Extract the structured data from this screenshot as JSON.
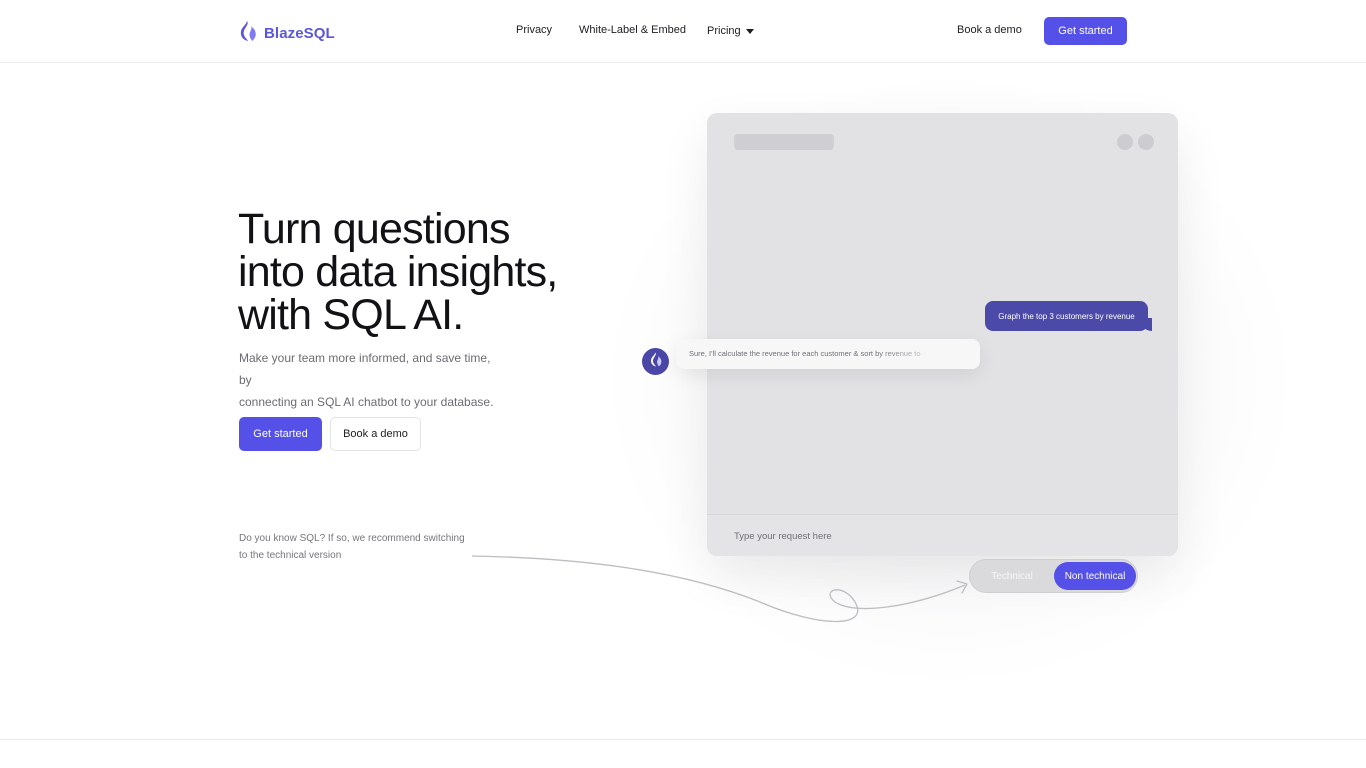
{
  "header": {
    "brand": "BlazeSQL",
    "nav": [
      {
        "label": "Privacy"
      },
      {
        "label": "White-Label & Embed"
      },
      {
        "label": "Pricing"
      }
    ],
    "book_demo": "Book a demo",
    "get_started": "Get started"
  },
  "hero": {
    "title_lines": [
      "Turn questions",
      "into data insights,",
      "with SQL AI."
    ],
    "subtitle_lines": [
      "Make your team more informed, and save time, by",
      "connecting an SQL AI chatbot to your database."
    ],
    "primary_cta": "Get started",
    "secondary_cta": "Book a demo",
    "hint_lines": [
      "Do you know SQL? If so, we recommend switching",
      "to the technical version"
    ]
  },
  "chat": {
    "user_message": "Graph the top 3 customers by revenue",
    "bot_message": "Sure, I'll calculate the revenue for each customer & sort by revenue to",
    "input_placeholder": "Type your request here"
  },
  "toggle": {
    "options": [
      "Technical",
      "Non technical"
    ],
    "selected": "Non technical"
  },
  "colors": {
    "accent": "#5450e8",
    "bubble": "#4c4aa8",
    "brand_text": "#5b57d9"
  }
}
